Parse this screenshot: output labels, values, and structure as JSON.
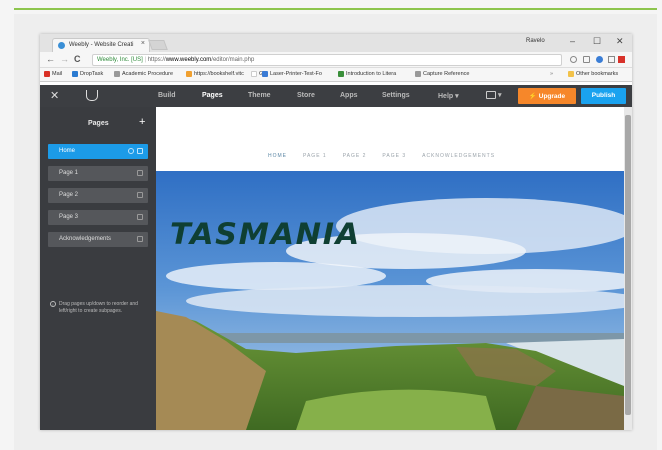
{
  "browser": {
    "tab_title": "Weebly - Website Creati",
    "tab_close": "×",
    "profile_name": "Ravelo",
    "win_min": "–",
    "win_max": "☐",
    "win_close": "✕",
    "nav_back": "←",
    "nav_forward": "→",
    "nav_reload": "C",
    "url_secure": "Weebly, Inc. [US]",
    "url_scheme": "https://",
    "url_host": "www.weebly.com",
    "url_path": "/editor/main.php"
  },
  "bookmarks": [
    {
      "label": "Mail",
      "color": "#d93025"
    },
    {
      "label": "DropTask",
      "color": "#2b7bd1"
    },
    {
      "label": "Academic Procedure",
      "color": "#999999"
    },
    {
      "label": "https://bookshelf.vitc",
      "color": "#f0a030"
    },
    {
      "label": "G",
      "color": "#ffffff"
    },
    {
      "label": "Laser-Printer-Test-Fo",
      "color": "#3a7bd5"
    },
    {
      "label": "Introduction to Litera",
      "color": "#3a8f3a"
    },
    {
      "label": "Capture Reference",
      "color": "#999999"
    }
  ],
  "bookmarks_more": "»",
  "bookmarks_other": "Other bookmarks",
  "toolbar": {
    "close": "✕",
    "nav": [
      "Build",
      "Pages",
      "Theme",
      "Store",
      "Apps",
      "Settings",
      "Help ▾"
    ],
    "active": "Pages",
    "device_caret": "▾",
    "upgrade": "⚡ Upgrade",
    "publish": "Publish"
  },
  "sidebar": {
    "title": "Pages",
    "add": "+",
    "pages": [
      "Home",
      "Page 1",
      "Page 2",
      "Page 3",
      "Acknowledgements"
    ],
    "hint": "Drag pages up/down to reorder and left/right to create subpages.",
    "hint_icon": "i"
  },
  "site": {
    "nav": [
      "HOME",
      "PAGE 1",
      "PAGE 2",
      "PAGE 3",
      "ACKNOWLEDGEMENTS"
    ],
    "hero_title": "TASMANIA"
  }
}
